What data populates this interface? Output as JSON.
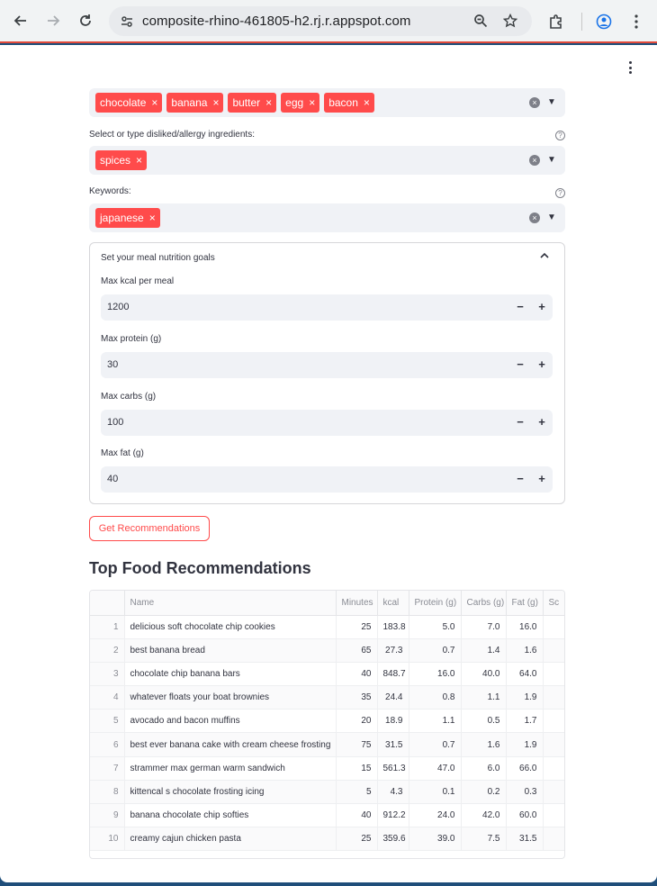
{
  "browser": {
    "url": "composite-rhino-461805-h2.rj.r.appspot.com",
    "back_icon": "arrow-left-icon",
    "forward_icon": "arrow-right-icon",
    "reload_icon": "reload-icon"
  },
  "filters": {
    "liked_ingredients": [
      "chocolate",
      "banana",
      "butter",
      "egg",
      "bacon"
    ],
    "disliked_label": "Select or type disliked/allergy ingredients:",
    "disliked_ingredients": [
      "spices"
    ],
    "keywords_label": "Keywords:",
    "keywords": [
      "japanese"
    ]
  },
  "nutrition": {
    "title": "Set your meal nutrition goals",
    "kcal_label": "Max kcal per meal",
    "kcal_value": "1200",
    "protein_label": "Max protein (g)",
    "protein_value": "30",
    "carbs_label": "Max carbs (g)",
    "carbs_value": "100",
    "fat_label": "Max fat (g)",
    "fat_value": "40",
    "minus": "−",
    "plus": "+"
  },
  "button_label": "Get Recommendations",
  "results_title": "Top Food Recommendations",
  "table": {
    "columns": [
      "",
      "Name",
      "Minutes",
      "kcal",
      "Protein (g)",
      "Carbs (g)",
      "Fat (g)",
      "Sc"
    ],
    "rows": [
      [
        "1",
        "delicious soft chocolate chip cookies",
        "25",
        "183.8",
        "5.0",
        "7.0",
        "16.0",
        ""
      ],
      [
        "2",
        "best banana bread",
        "65",
        "27.3",
        "0.7",
        "1.4",
        "1.6",
        ""
      ],
      [
        "3",
        "chocolate chip banana bars",
        "40",
        "848.7",
        "16.0",
        "40.0",
        "64.0",
        ""
      ],
      [
        "4",
        "whatever floats your boat  brownies",
        "35",
        "24.4",
        "0.8",
        "1.1",
        "1.9",
        ""
      ],
      [
        "5",
        "avocado and bacon muffins",
        "20",
        "18.9",
        "1.1",
        "0.5",
        "1.7",
        ""
      ],
      [
        "6",
        "best ever banana cake with cream cheese frosting",
        "75",
        "31.5",
        "0.7",
        "1.6",
        "1.9",
        ""
      ],
      [
        "7",
        "strammer max   german warm sandwich",
        "15",
        "561.3",
        "47.0",
        "6.0",
        "66.0",
        ""
      ],
      [
        "8",
        "kittencal s chocolate frosting icing",
        "5",
        "4.3",
        "0.1",
        "0.2",
        "0.3",
        ""
      ],
      [
        "9",
        "banana chocolate chip softies",
        "40",
        "912.2",
        "24.0",
        "42.0",
        "60.0",
        ""
      ],
      [
        "10",
        "creamy cajun chicken pasta",
        "25",
        "359.6",
        "39.0",
        "7.5",
        "31.5",
        ""
      ]
    ]
  }
}
